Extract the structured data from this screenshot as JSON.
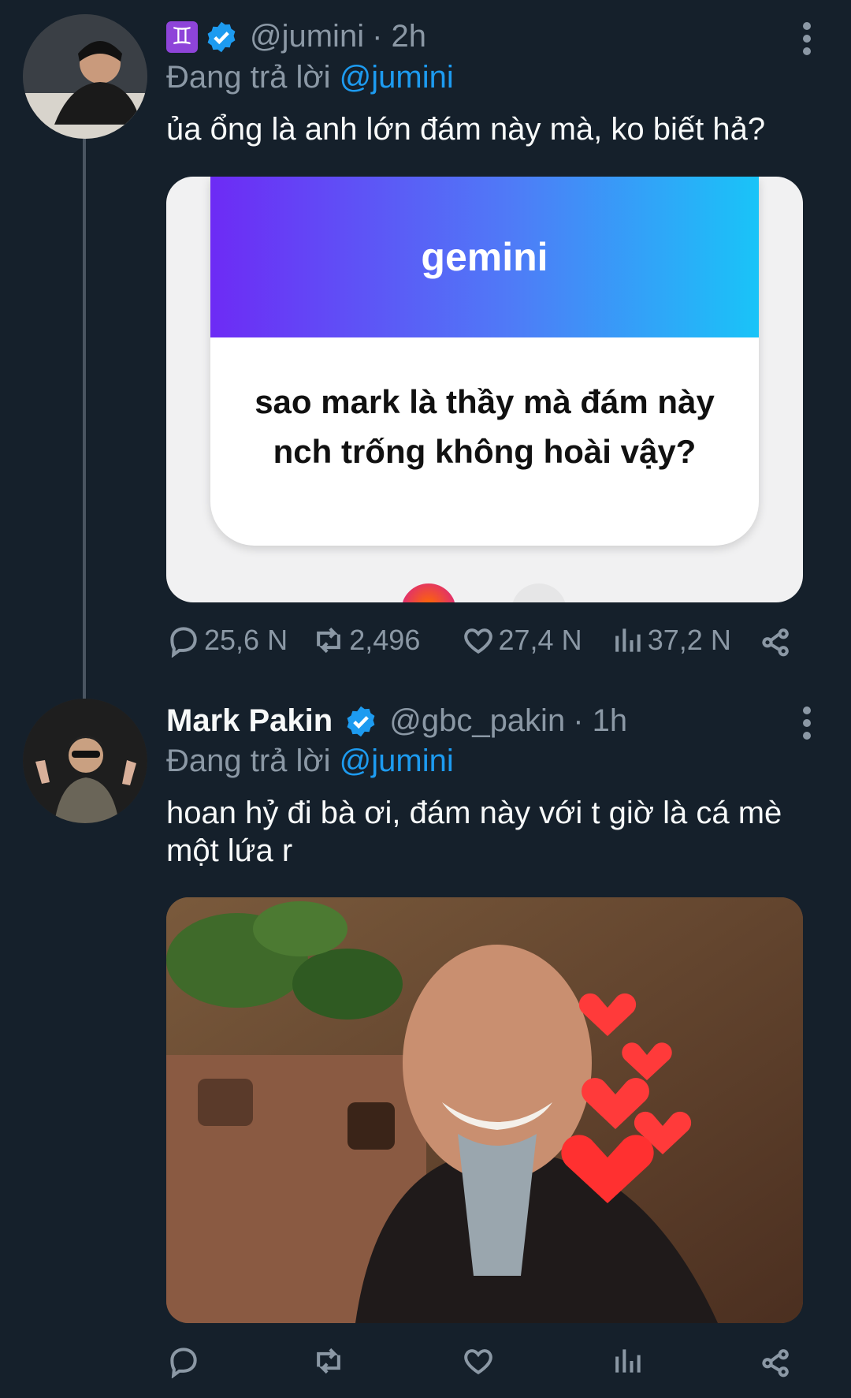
{
  "tweets": [
    {
      "zodiac_icon": "gemini-sign-icon",
      "verified": true,
      "handle": "@jumini",
      "time": "· 2h",
      "replying_label": "Đang trả lời",
      "replying_to": "@jumini",
      "text": "ủa ổng là anh lớn đám này mà, ko biết hả?",
      "card": {
        "brand": "gemini",
        "question": "sao mark là thầy mà đám này nch trống không hoài vậy?"
      },
      "stats": {
        "replies": "25,6 N",
        "retweets": "2,496",
        "likes": "27,4 N",
        "views": "37,2 N"
      }
    },
    {
      "name": "Mark Pakin",
      "verified": true,
      "handle": "@gbc_pakin",
      "time": "· 1h",
      "replying_label": "Đang trả lời",
      "replying_to": "@jumini",
      "text": "hoan hỷ đi bà ơi, đám này với t giờ là cá mè một lứa r"
    }
  ],
  "colors": {
    "background": "#15202b",
    "muted": "#8b98a5",
    "accent": "#1d9bf0",
    "verified": "#1d9bf0"
  }
}
